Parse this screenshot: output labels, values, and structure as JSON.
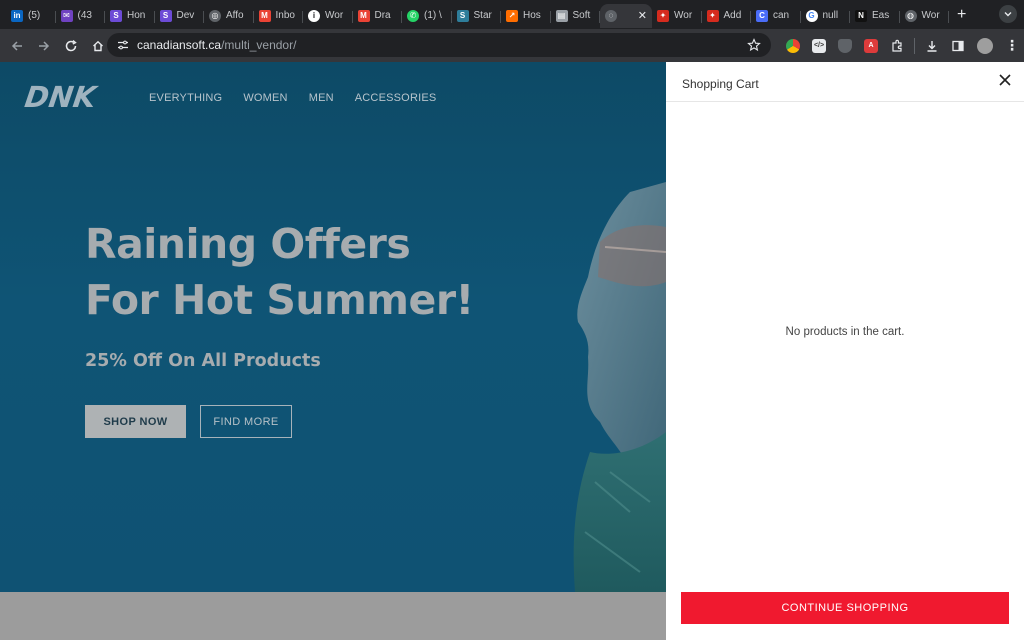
{
  "browser": {
    "tabs": [
      {
        "label": "(5)",
        "icon": "linkedin-icon",
        "color": "#0a66c2",
        "glyph": "in"
      },
      {
        "label": "(43",
        "icon": "mail-icon",
        "color": "#6f42c1",
        "glyph": "✉"
      },
      {
        "label": "Hon",
        "icon": "s-app-icon",
        "color": "#6c4bd6",
        "glyph": "S"
      },
      {
        "label": "Dev",
        "icon": "s-app-icon",
        "color": "#6c4bd6",
        "glyph": "S"
      },
      {
        "label": "Affo",
        "icon": "openai-icon",
        "color": "#5f6368",
        "glyph": "◎"
      },
      {
        "label": "Inbo",
        "icon": "gmail-icon",
        "color": "#ea4335",
        "glyph": "M"
      },
      {
        "label": "Wor",
        "icon": "info-icon",
        "color": "#ffffff",
        "glyph": "i"
      },
      {
        "label": "Dra",
        "icon": "gmail-icon",
        "color": "#ea4335",
        "glyph": "M"
      },
      {
        "label": "(1) \\",
        "icon": "whatsapp-icon",
        "color": "#25d366",
        "glyph": "✆"
      },
      {
        "label": "Star",
        "icon": "s-app-icon",
        "color": "#2e7d9a",
        "glyph": "S"
      },
      {
        "label": "Hos",
        "icon": "chart-icon",
        "color": "#ff6d00",
        "glyph": "↗"
      },
      {
        "label": "Soft",
        "icon": "doc-icon",
        "color": "#9aa0a6",
        "glyph": "▤"
      },
      {
        "label": "",
        "icon": "loading-icon",
        "color": "#5f6368",
        "glyph": "◌",
        "active": true
      },
      {
        "label": "Wor",
        "icon": "canada-flag-icon",
        "color": "#d52b1e",
        "glyph": "✦"
      },
      {
        "label": "Add",
        "icon": "canada-flag-icon",
        "color": "#d52b1e",
        "glyph": "✦"
      },
      {
        "label": "can",
        "icon": "c-app-icon",
        "color": "#4a6cf7",
        "glyph": "C"
      },
      {
        "label": "null",
        "icon": "google-icon",
        "color": "#ffffff",
        "glyph": "G"
      },
      {
        "label": "Eas",
        "icon": "n-app-icon",
        "color": "#111111",
        "glyph": "N"
      },
      {
        "label": "Wor",
        "icon": "globe-icon",
        "color": "#5f6368",
        "glyph": "◍"
      }
    ],
    "url_host": "canadiansoft.ca",
    "url_path": "/multi_vendor/"
  },
  "site": {
    "logo": "DNK",
    "nav": [
      "EVERYTHING",
      "WOMEN",
      "MEN",
      "ACCESSORIES"
    ],
    "hero": {
      "headline_line1": "Raining Offers",
      "headline_line2": "For Hot Summer!",
      "subheadline": "25% Off On All Products",
      "primary_button": "SHOP NOW",
      "secondary_button": "FIND MORE"
    }
  },
  "cart": {
    "title": "Shopping Cart",
    "empty_message": "No products in the cart.",
    "continue_button": "CONTINUE SHOPPING",
    "accent_color": "#f0192f"
  }
}
